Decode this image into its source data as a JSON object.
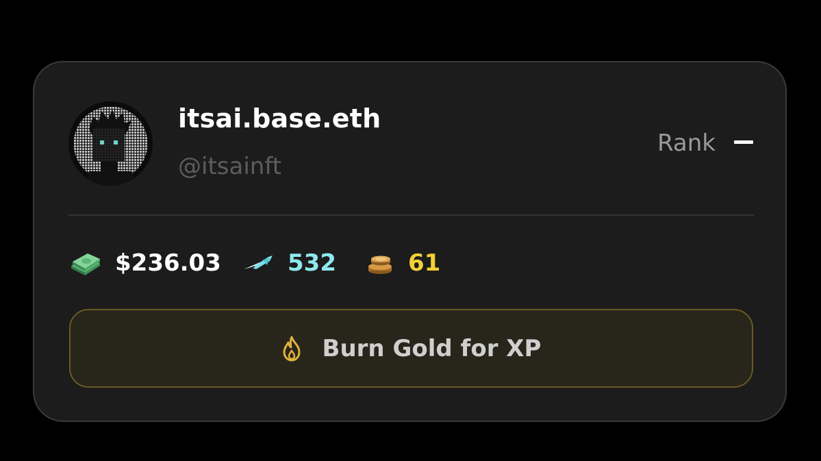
{
  "profile": {
    "display_name": "itsai.base.eth",
    "handle": "@itsainft",
    "avatar_icon": "pixel-punk-avatar"
  },
  "rank": {
    "label": "Rank",
    "value": "–"
  },
  "stats": {
    "cash": {
      "icon": "cash-stack-icon",
      "value": "$236.03",
      "color": "#ffffff"
    },
    "xp": {
      "icon": "dart-icon",
      "value": "532",
      "color": "#8ee8ee"
    },
    "gold": {
      "icon": "gold-coins-icon",
      "value": "61",
      "color": "#f3d035"
    }
  },
  "action": {
    "icon": "flame-icon",
    "label": "Burn Gold for XP",
    "accent": "#6a5a22"
  }
}
